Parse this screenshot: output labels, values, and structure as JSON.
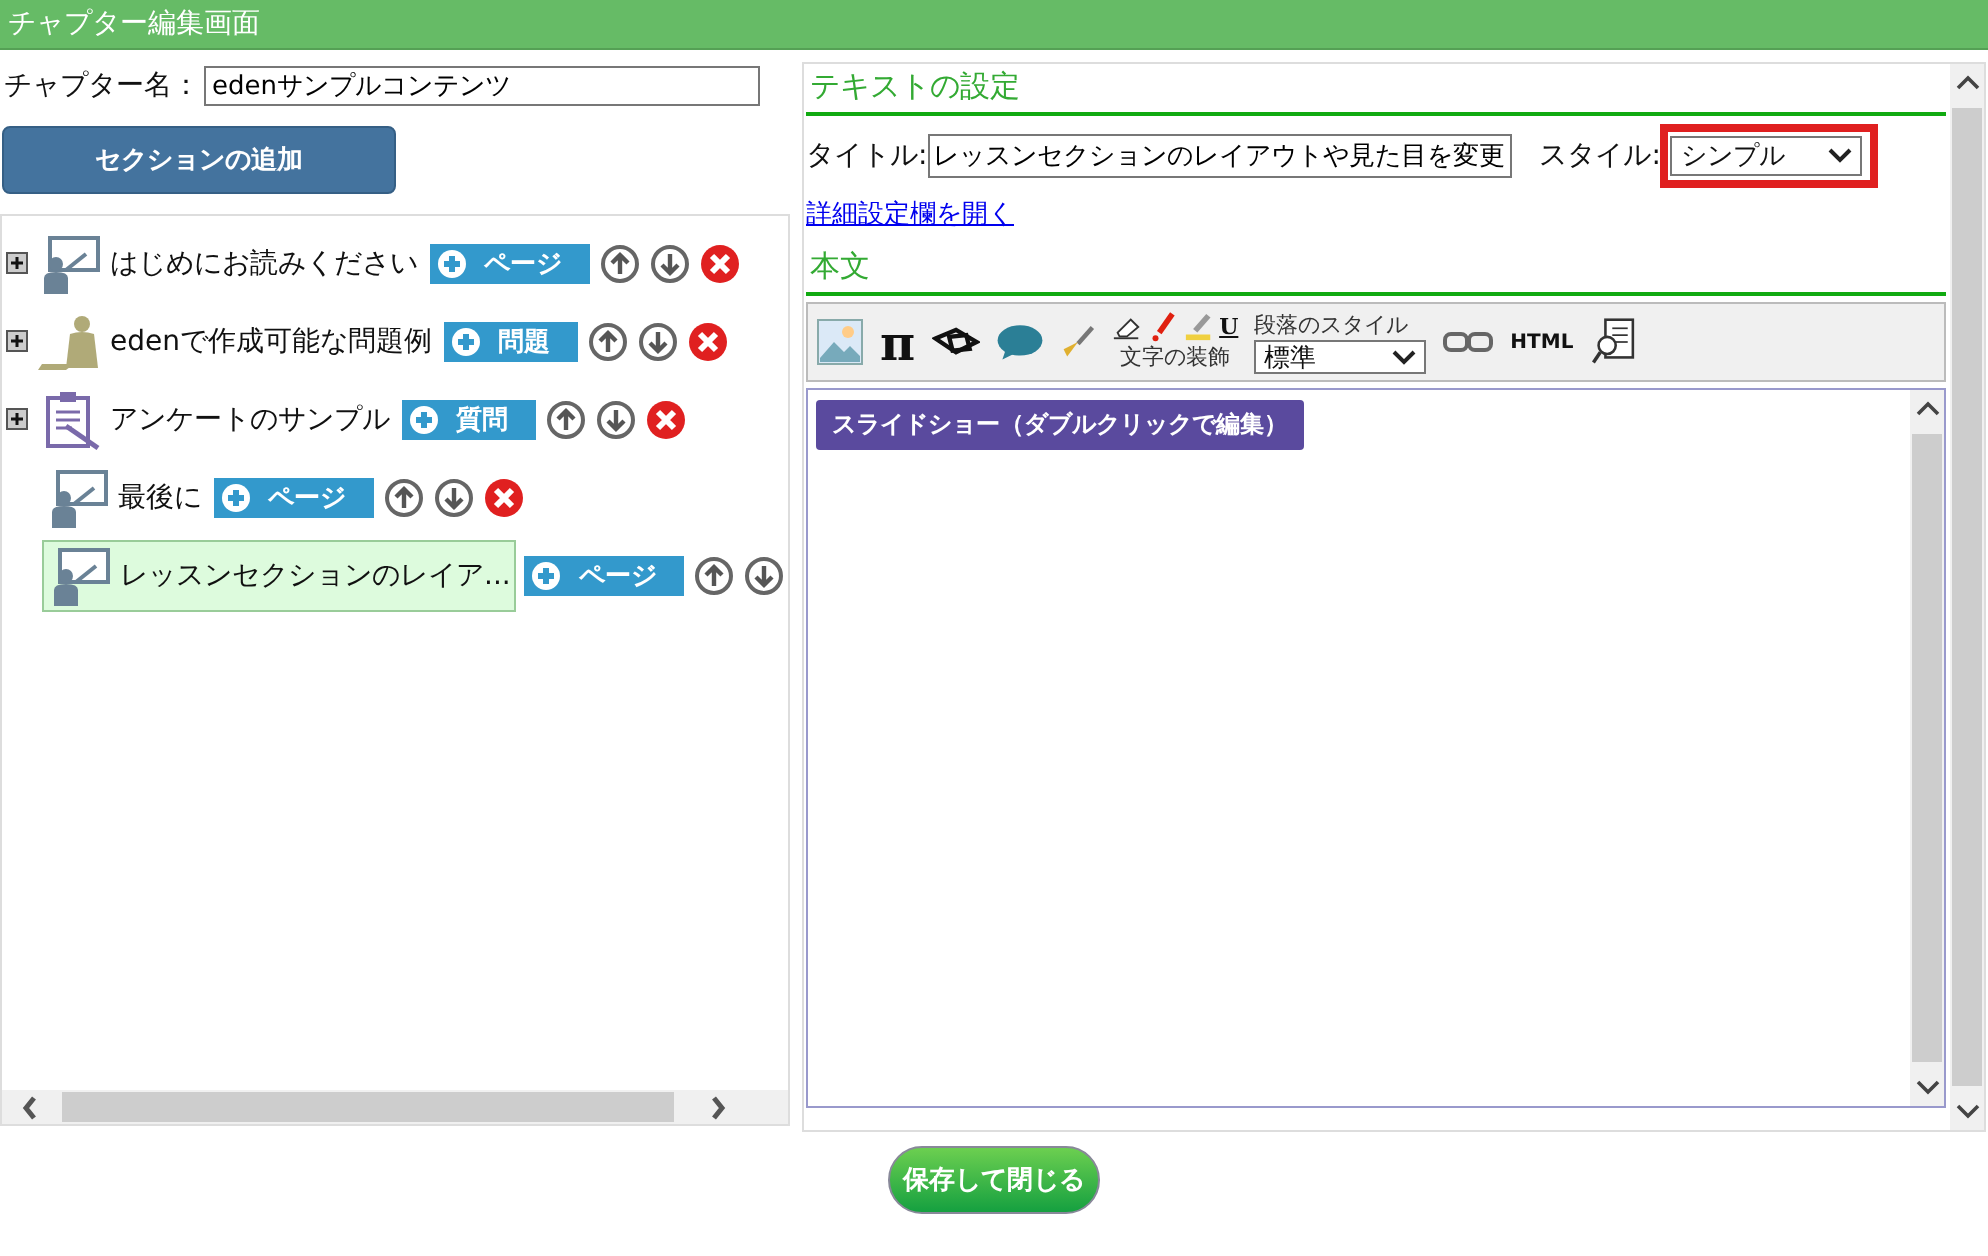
{
  "window": {
    "title": "チャプター編集画面"
  },
  "chapter": {
    "label": "チャプター名：",
    "value": "edenサンプルコンテンツ"
  },
  "add_section_button": "セクションの追加",
  "sections": [
    {
      "title": "はじめにお読みください",
      "kind": "teacher",
      "collapsible": true,
      "selected": false,
      "add_label": "ページ",
      "deletable": true
    },
    {
      "title": "edenで作成可能な問題例",
      "kind": "student",
      "collapsible": true,
      "selected": false,
      "add_label": "問題",
      "deletable": true
    },
    {
      "title": "アンケートのサンプル",
      "kind": "survey",
      "collapsible": true,
      "selected": false,
      "add_label": "質問",
      "deletable": true
    },
    {
      "title": "最後に",
      "kind": "teacher",
      "collapsible": false,
      "selected": false,
      "add_label": "ページ",
      "deletable": true
    },
    {
      "title": "レッスンセクションのレイア...",
      "kind": "teacher",
      "collapsible": false,
      "selected": true,
      "add_label": "ページ",
      "deletable": false
    }
  ],
  "text_settings": {
    "heading": "テキストの設定",
    "title_label": "タイトル:",
    "title_value": "レッスンセクションのレイアウトや見た目を変更",
    "style_label": "スタイル:",
    "style_value": "シンプル",
    "details_link": "詳細設定欄を開く"
  },
  "body": {
    "heading": "本文",
    "toolbar": {
      "pi": "π",
      "underline": "U",
      "decoration_label": "文字の装飾",
      "paragraph_label": "段落のスタイル",
      "paragraph_value": "標準",
      "html": "HTML"
    },
    "slideshow_button": "スライドショー（ダブルクリックで編集）"
  },
  "save_button": "保存して閉じる"
}
